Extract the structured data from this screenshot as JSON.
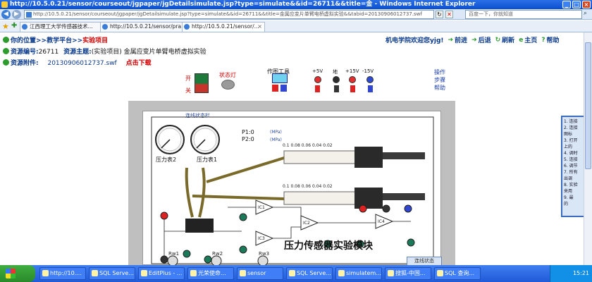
{
  "window": {
    "title": "http://10.5.0.21/sensor/courseout/jgpaper/jgDetailsimulate.jsp?type=simulate&&id=26711&&title=金 - Windows Internet Explorer",
    "min": "_",
    "max": "□",
    "close": "×"
  },
  "address_bar": {
    "url": "http://10.5.0.21/sensor/courseout/jgpaper/jgDetailsimulate.jsp?type=simulate&&id=26711&&title=金属应变片单臂电桥虚拟实验&&tabid=20130906012737.swf",
    "search_placeholder": "百度一下，你就知道",
    "back": "◀",
    "forward": "▶",
    "refresh": "↻",
    "stop": "✕",
    "search_go": "⌕"
  },
  "tabs": [
    {
      "label": "江西理工大学传感器技术...",
      "active": false
    },
    {
      "label": "http://10.5.0.21/sensor/pra...",
      "active": false
    },
    {
      "label": "http://10.5.0.21/sensor/...",
      "active": true
    }
  ],
  "breadcrumb": {
    "prefix": "你的位置>>教学平台>>",
    "current": "实验项目"
  },
  "top_links": {
    "welcome": "机电学院欢迎您yjg!",
    "forward": "前进",
    "back": "后退",
    "refresh": "刷新",
    "home": "主页",
    "help": "帮助"
  },
  "resource": {
    "id_label": "资源编号:",
    "id_value": "26711",
    "topic_label": "资源主题:",
    "topic_value": "(实验项目) 金属应变片单臂电桥虚拟实验",
    "attach_label": "资源附件:",
    "attach_file": "20130906012737.swf",
    "download": "点击下载"
  },
  "controls": {
    "switch_on": "开",
    "switch_off": "关",
    "status_lamp": "状态灯",
    "tools": "作图工具",
    "pwr_plus5": "+5V",
    "pwr_gnd": "地",
    "pwr_plus15": "+15V",
    "pwr_minus15": "-15V",
    "steps_1": "操作",
    "steps_2": "步骤",
    "steps_3": "帮助"
  },
  "sim": {
    "panel_title": "连线状态栏",
    "gauge2": "压力表2",
    "gauge1": "压力表1",
    "p1": "P1:",
    "p2": "P2:",
    "p1_val": "0",
    "p2_val": "0",
    "mpa": "(MPa)",
    "scale": "0.1  0.08  0.06  0.04  0.02",
    "module_title": "压力传感器实验模块",
    "status_button": "连线状态",
    "rw1": "Rw1",
    "rw2": "Rw2",
    "rw3": "Rw3",
    "ic1": "IC1",
    "ic2": "IC2",
    "ic3": "IC3",
    "ic4": "IC4"
  },
  "side_tab_lines": [
    "1. 连接",
    "2. 连接",
    "   图标",
    "3. 打开",
    "   上的",
    "4. 调时",
    "5. 连接",
    "6. 调节",
    "7. 所有",
    "   出调",
    "8. 实验",
    "   来用",
    "9. 最",
    "   的"
  ],
  "taskbar": {
    "items": [
      "http://10....",
      "SQL Serve...",
      "EditPlus - ...",
      "光荣使命...",
      "sensor",
      "SQL Serve...",
      "simulatem...",
      "搜狐-中国...",
      "SQL 查询..."
    ],
    "clock": "15:21"
  }
}
